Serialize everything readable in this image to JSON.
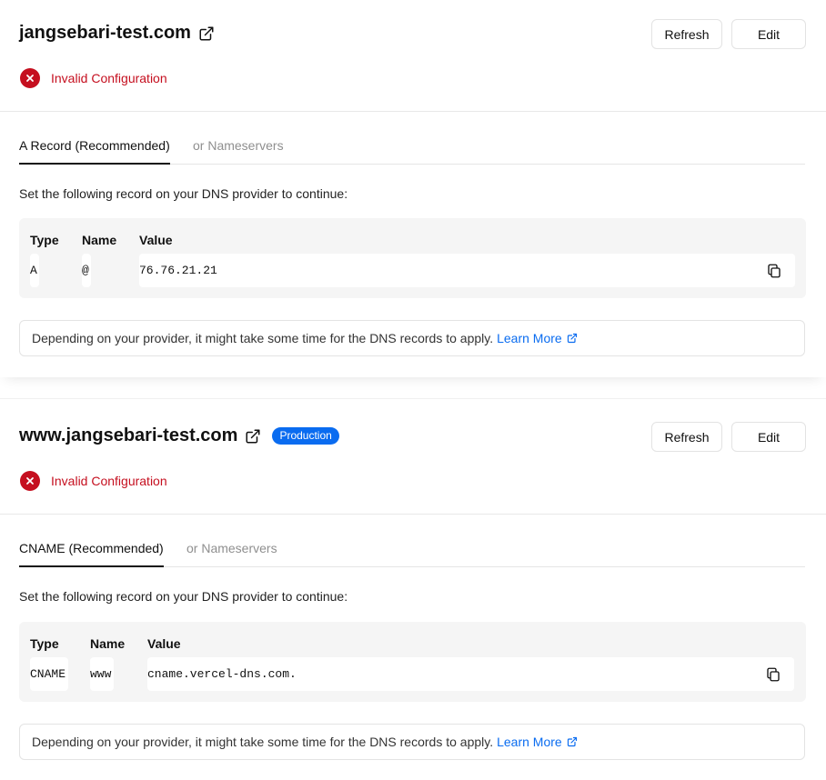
{
  "domains": [
    {
      "title": "jangsebari-test.com",
      "badge": "",
      "refresh_label": "Refresh",
      "edit_label": "Edit",
      "status": "Invalid Configuration",
      "tabs": [
        "A Record (Recommended)",
        "or Nameservers"
      ],
      "active_tab": 0,
      "instruction": "Set the following record on your DNS provider to continue:",
      "columns": [
        "Type",
        "Name",
        "Value"
      ],
      "record": {
        "type": "A",
        "name": "@",
        "value": "76.76.21.21"
      },
      "notice": "Depending on your provider, it might take some time for the DNS records to apply.",
      "learn_more": "Learn More"
    },
    {
      "title": "www.jangsebari-test.com",
      "badge": "Production",
      "refresh_label": "Refresh",
      "edit_label": "Edit",
      "status": "Invalid Configuration",
      "tabs": [
        "CNAME (Recommended)",
        "or Nameservers"
      ],
      "active_tab": 0,
      "instruction": "Set the following record on your DNS provider to continue:",
      "columns": [
        "Type",
        "Name",
        "Value"
      ],
      "record": {
        "type": "CNAME",
        "name": "www",
        "value": "cname.vercel-dns.com."
      },
      "notice": "Depending on your provider, it might take some time for the DNS records to apply.",
      "learn_more": "Learn More"
    }
  ],
  "colors": {
    "error": "#c50f1f",
    "link": "#0a6cf0",
    "badge": "#0a6cf0"
  }
}
